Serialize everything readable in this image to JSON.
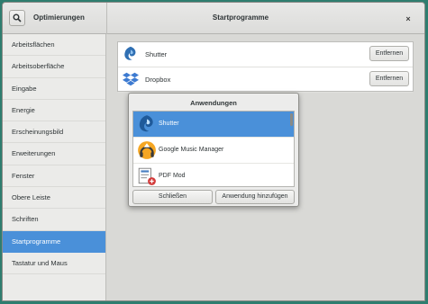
{
  "header": {
    "app_title": "Optimierungen",
    "panel_title": "Startprogramme",
    "close_glyph": "×",
    "search_icon": "search-icon"
  },
  "sidebar": {
    "items": [
      {
        "label": "Arbeitsflächen",
        "selected": false
      },
      {
        "label": "Arbeitsoberfläche",
        "selected": false
      },
      {
        "label": "Eingabe",
        "selected": false
      },
      {
        "label": "Energie",
        "selected": false
      },
      {
        "label": "Erscheinungsbild",
        "selected": false
      },
      {
        "label": "Erweiterungen",
        "selected": false
      },
      {
        "label": "Fenster",
        "selected": false
      },
      {
        "label": "Obere Leiste",
        "selected": false
      },
      {
        "label": "Schriften",
        "selected": false
      },
      {
        "label": "Startprogramme",
        "selected": true
      },
      {
        "label": "Tastatur und Maus",
        "selected": false
      }
    ]
  },
  "startup_apps": [
    {
      "name": "Shutter",
      "icon": "shutter-icon",
      "remove_label": "Entfernen"
    },
    {
      "name": "Dropbox",
      "icon": "dropbox-icon",
      "remove_label": "Entfernen"
    }
  ],
  "dialog": {
    "title": "Anwendungen",
    "apps": [
      {
        "name": "Shutter",
        "icon": "shutter-icon",
        "selected": true
      },
      {
        "name": "Google Music Manager",
        "icon": "google-music-icon",
        "selected": false
      },
      {
        "name": "PDF Mod",
        "icon": "pdf-mod-icon",
        "selected": false
      }
    ],
    "close_label": "Schließen",
    "add_label": "Anwendung hinzufügen"
  },
  "colors": {
    "desktop": "#2e7d6f",
    "accent": "#4a90d9",
    "window_bg": "#d9d9d6"
  }
}
